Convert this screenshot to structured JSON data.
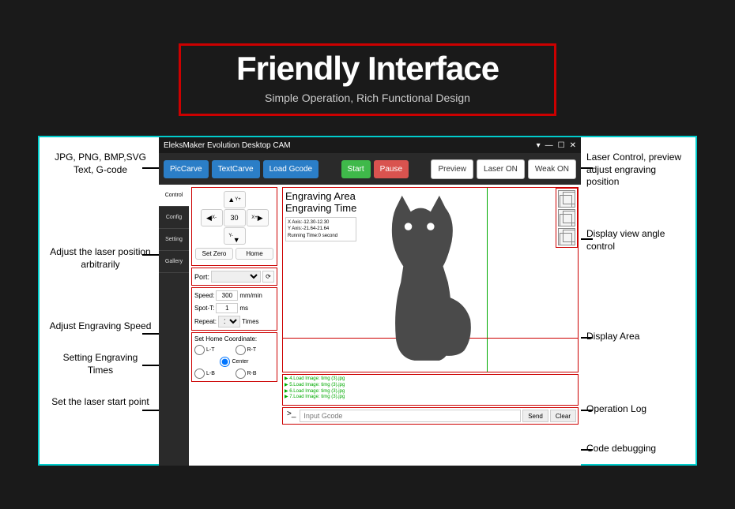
{
  "hero": {
    "title": "Friendly Interface",
    "subtitle": "Simple Operation, Rich Functional Design"
  },
  "app": {
    "title": "EleksMaker Evolution Desktop CAM",
    "window_controls": {
      "chevron": "▾",
      "min": "—",
      "max": "☐",
      "close": "✕"
    }
  },
  "toolbar": {
    "pic_carve": "PicCarve",
    "text_carve": "TextCarve",
    "load_gcode": "Load Gcode",
    "start": "Start",
    "pause": "Pause",
    "preview": "Preview",
    "laser_on": "Laser ON",
    "weak_on": "Weak ON"
  },
  "sidebar": {
    "tabs": [
      "Control",
      "Config",
      "Setting",
      "Gallery"
    ]
  },
  "jog": {
    "up": "Y+",
    "down": "Y-",
    "left": "X-",
    "right": "X+",
    "step": "30",
    "set_zero": "Set Zero",
    "home": "Home"
  },
  "port": {
    "label": "Port:",
    "refresh": "⟳"
  },
  "fields": {
    "speed_label": "Speed:",
    "speed_value": "300",
    "speed_unit": "mm/min",
    "spot_label": "Spot-T:",
    "spot_value": "1",
    "spot_unit": "ms",
    "repeat_label": "Repeat:",
    "repeat_value": "1",
    "repeat_unit": "Times"
  },
  "home": {
    "title": "Set Home Coordinate:",
    "options": {
      "lt": "L-T",
      "rt": "R-T",
      "center": "Center",
      "lb": "L-B",
      "rb": "R-B"
    },
    "selected": "center"
  },
  "info": {
    "area": "Engraving Area",
    "time": "Engraving Time",
    "stats": {
      "x": "X Axis:-12.30-12.30",
      "y": "Y Axis:-21.64-21.64",
      "rt": "Running Time:0 second"
    }
  },
  "log": {
    "lines": [
      "▶ 4.Load Image: timg (3).jpg",
      "▶ 5.Load Image: timg (3).jpg",
      "▶ 6.Load Image: timg (3).jpg",
      "▶ 7.Load Image: timg (3).jpg"
    ]
  },
  "gcode": {
    "prompt": ">_",
    "placeholder": "Input Gcode",
    "send": "Send",
    "clear": "Clear"
  },
  "callouts": {
    "c1": "JPG, PNG, BMP,SVG Text, G-code",
    "c2": "Adjust the laser position arbitrarily",
    "c3": "Adjust Engraving Speed",
    "c4": "Setting Engraving Times",
    "c5": "Set the laser start point",
    "r1": "Laser Control, preview adjust engraving position",
    "r2": "Display view angle control",
    "r3": "Display Area",
    "r4": "Operation Log",
    "r5": "Code debugging"
  }
}
